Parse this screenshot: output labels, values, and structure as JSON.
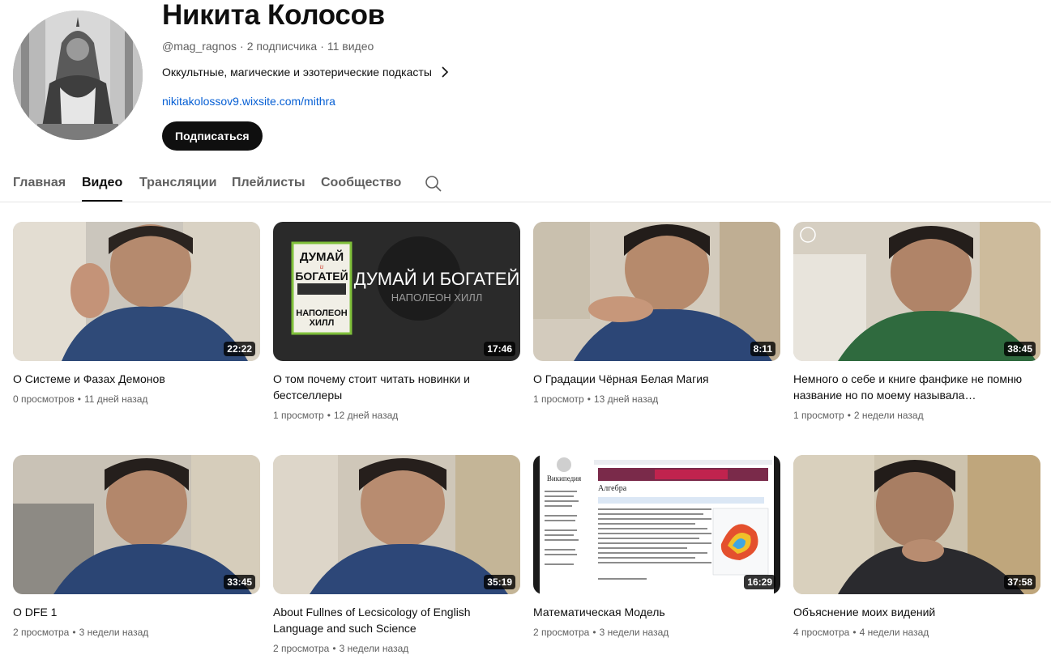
{
  "channel": {
    "title": "Никита Колосов",
    "handle": "@mag_ragnos",
    "subscribers": "2 подписчика",
    "videos_count": "11 видео",
    "meta_separator": "·",
    "description": "Оккультные, магические и эзотерические подкасты",
    "link": "nikitakolossov9.wixsite.com/mithra",
    "subscribe_label": "Подписаться",
    "avatar_icon": "statue-avatar"
  },
  "tabs": [
    {
      "label": "Главная",
      "active": false
    },
    {
      "label": "Видео",
      "active": true
    },
    {
      "label": "Трансляции",
      "active": false
    },
    {
      "label": "Плейлисты",
      "active": false
    },
    {
      "label": "Сообщество",
      "active": false
    }
  ],
  "tab_search_icon": "search-icon",
  "meta_dot": "•",
  "videos": [
    {
      "title": "О Системе и Фазах Демонов",
      "duration": "22:22",
      "views": "0 просмотров",
      "age": "11 дней назад",
      "thumb": "man-blue-shirt-hand"
    },
    {
      "title": "О том почему стоит читать новинки и бестселлеры",
      "duration": "17:46",
      "views": "1 просмотр",
      "age": "12 дней назад",
      "thumb": "book-cover",
      "thumb_text": {
        "book_title_1": "ДУМАЙ",
        "book_title_2": "и",
        "book_title_3": "БОГАТЕЙ",
        "book_author_1": "НАПОЛЕОН",
        "book_author_2": "ХИЛЛ",
        "banner_title": "ДУМАЙ И БОГАТЕЙ",
        "banner_author": "НАПОЛЕОН ХИЛЛ"
      }
    },
    {
      "title": "О Градации Чёрная Белая Магия",
      "duration": "8:11",
      "views": "1 просмотр",
      "age": "13 дней назад",
      "thumb": "man-blue-shirt-hand"
    },
    {
      "title": "Немного о себе и книге фанфике не помню название но по моему называла…",
      "duration": "38:45",
      "views": "1 просмотр",
      "age": "2 недели назад",
      "thumb": "man-green-shirt"
    },
    {
      "title": "О DFE 1",
      "duration": "33:45",
      "views": "2 просмотра",
      "age": "3 недели назад",
      "thumb": "man-blue-shirt"
    },
    {
      "title": "About Fullnes of Lecsicology of English Language and such Science",
      "duration": "35:19",
      "views": "2 просмотра",
      "age": "3 недели назад",
      "thumb": "man-blue-shirt"
    },
    {
      "title": "Математическая Модель",
      "duration": "16:29",
      "views": "2 просмотра",
      "age": "3 недели назад",
      "thumb": "wiki-page",
      "thumb_text": {
        "wiki_heading": "Алгебра",
        "wiki_logo_text": "Википедия"
      }
    },
    {
      "title": "Объяснение моих видений",
      "duration": "37:58",
      "views": "4 просмотра",
      "age": "4 недели назад",
      "thumb": "man-dark-thinking"
    }
  ]
}
